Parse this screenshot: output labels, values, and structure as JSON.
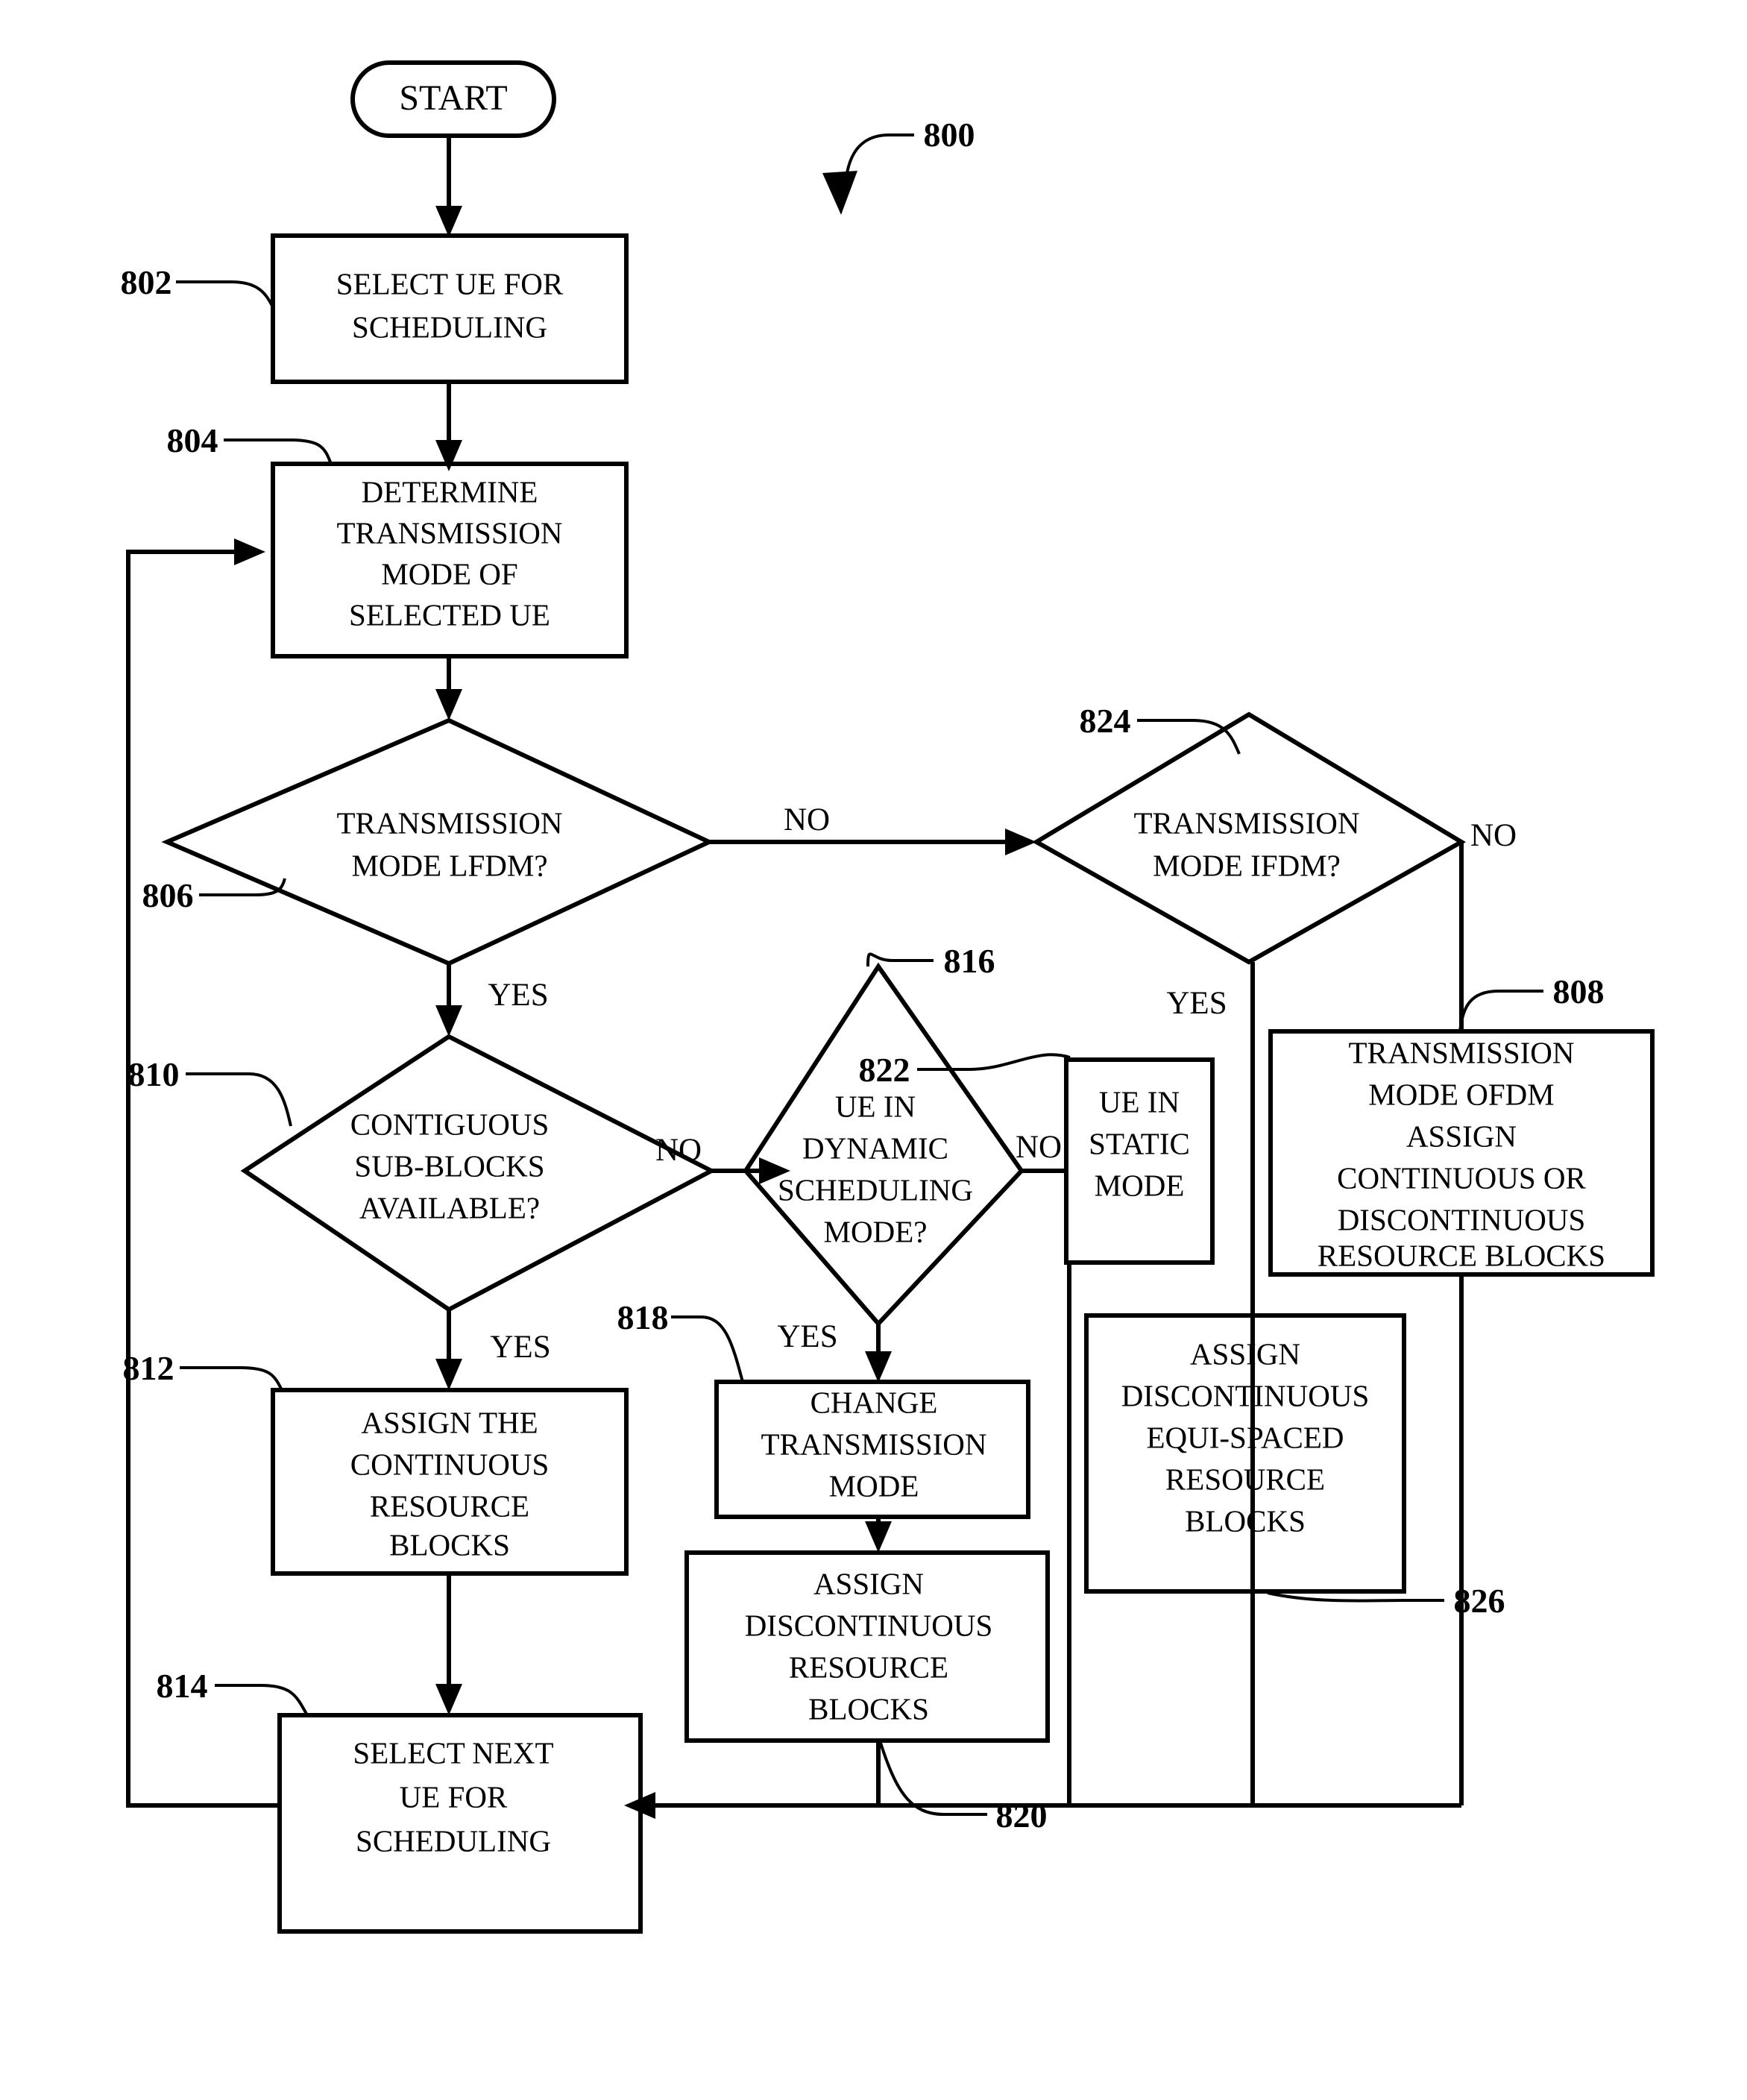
{
  "figure": {
    "reference_label": "800",
    "title": ""
  },
  "nodes": {
    "start": {
      "label": "START",
      "ref": ""
    },
    "n802": {
      "ref": "802",
      "lines": [
        "SELECT UE FOR",
        "SCHEDULING"
      ]
    },
    "n804": {
      "ref": "804",
      "lines": [
        "DETERMINE",
        "TRANSMISSION",
        "MODE OF",
        "SELECTED UE"
      ]
    },
    "n806": {
      "ref": "806",
      "lines": [
        "TRANSMISSION",
        "MODE LFDM?"
      ]
    },
    "n824": {
      "ref": "824",
      "lines": [
        "TRANSMISSION",
        "MODE IFDM?"
      ]
    },
    "n808": {
      "ref": "808",
      "lines": [
        "TRANSMISSION",
        "MODE OFDM",
        "ASSIGN",
        "CONTINUOUS OR",
        "DISCONTINUOUS",
        "RESOURCE BLOCKS"
      ]
    },
    "n810": {
      "ref": "810",
      "lines": [
        "CONTIGUOUS",
        "SUB-BLOCKS",
        "AVAILABLE?"
      ]
    },
    "n816": {
      "ref": "816",
      "lines": [
        "UE IN",
        "DYNAMIC",
        "SCHEDULING",
        "MODE?"
      ]
    },
    "n822": {
      "ref": "822",
      "lines": [
        "UE IN",
        "STATIC",
        "MODE"
      ]
    },
    "n812": {
      "ref": "812",
      "lines": [
        "ASSIGN THE",
        "CONTINUOUS",
        "RESOURCE",
        "BLOCKS"
      ]
    },
    "n818": {
      "ref": "818",
      "lines": [
        "CHANGE",
        "TRANSMISSION",
        "MODE"
      ]
    },
    "n820": {
      "ref": "820",
      "lines": [
        "ASSIGN",
        "DISCONTINUOUS",
        "RESOURCE",
        "BLOCKS"
      ]
    },
    "n826": {
      "ref": "826",
      "lines": [
        "ASSIGN",
        "DISCONTINUOUS",
        "EQUI-SPACED",
        "RESOURCE",
        "BLOCKS"
      ]
    },
    "n814": {
      "ref": "814",
      "lines": [
        "SELECT NEXT",
        "UE FOR",
        "SCHEDULING"
      ]
    }
  },
  "branch_labels": {
    "lfdm_no": "NO",
    "lfdm_yes": "YES",
    "ifdm_no": "NO",
    "ifdm_yes": "YES",
    "contiguous_no": "NO",
    "contiguous_yes": "YES",
    "dynamic_no": "NO",
    "dynamic_yes": "YES"
  },
  "colors": {
    "stroke": "#000000",
    "background": "#ffffff"
  }
}
